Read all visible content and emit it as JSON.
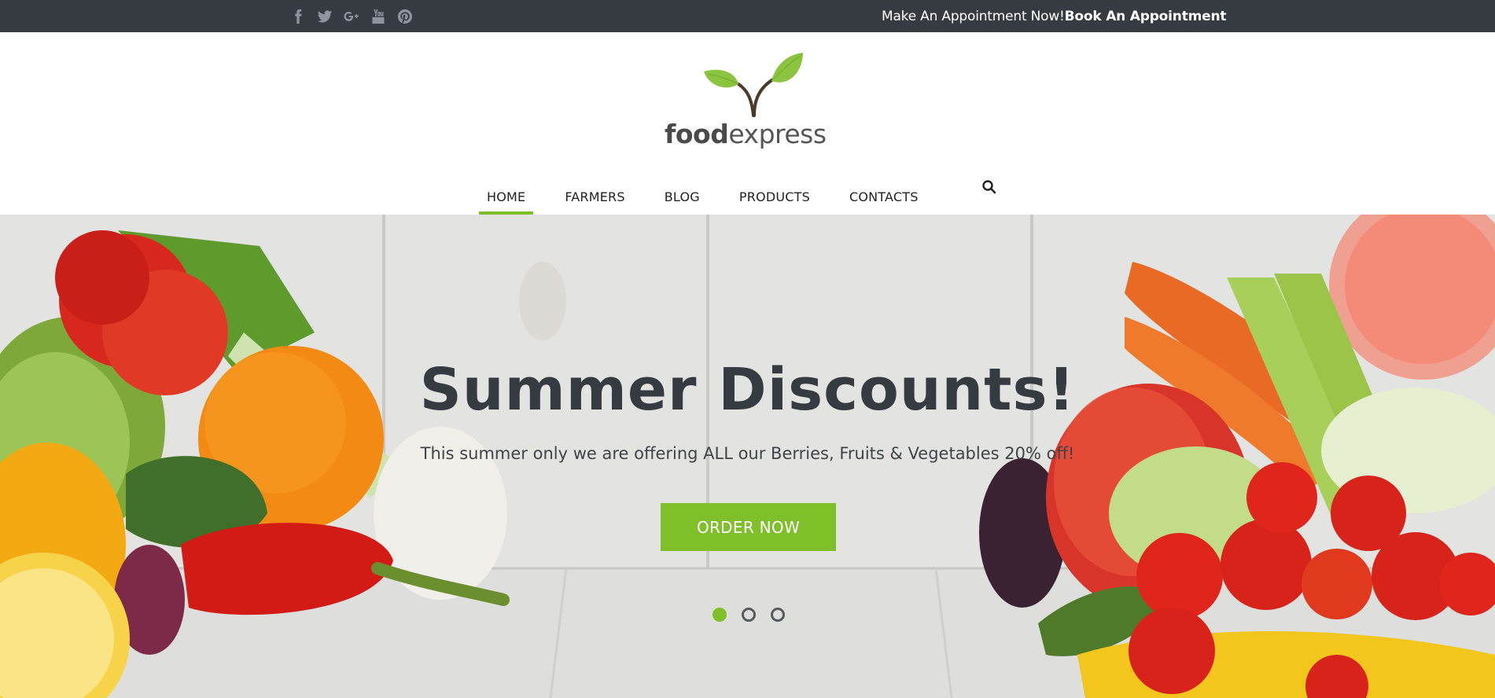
{
  "topbar": {
    "socials": [
      {
        "name": "facebook-icon",
        "glyph": "f"
      },
      {
        "name": "twitter-icon",
        "glyph": ""
      },
      {
        "name": "google-plus-icon",
        "glyph": "G+"
      },
      {
        "name": "youtube-icon",
        "glyph": ""
      },
      {
        "name": "pinterest-icon",
        "glyph": ""
      }
    ],
    "appointment_text": "Make An Appointment Now!",
    "appointment_link": "Book An Appointment"
  },
  "logo": {
    "bold": "food",
    "thin": "express",
    "leaf_color": "#8bc53f"
  },
  "nav": {
    "items": [
      "HOME",
      "FARMERS",
      "BLOG",
      "PRODUCTS",
      "CONTACTS"
    ],
    "active": "HOME",
    "search_icon": "search-icon"
  },
  "hero": {
    "title": "Summer Discounts!",
    "subtitle": "This summer only we are offering ALL our Berries, Fruits & Vegetables 20% off!",
    "button": "ORDER NOW",
    "slides": 3,
    "active_slide": 1
  },
  "colors": {
    "accent": "#7fbf2a",
    "topbar": "#353b41",
    "title": "#353b41"
  }
}
